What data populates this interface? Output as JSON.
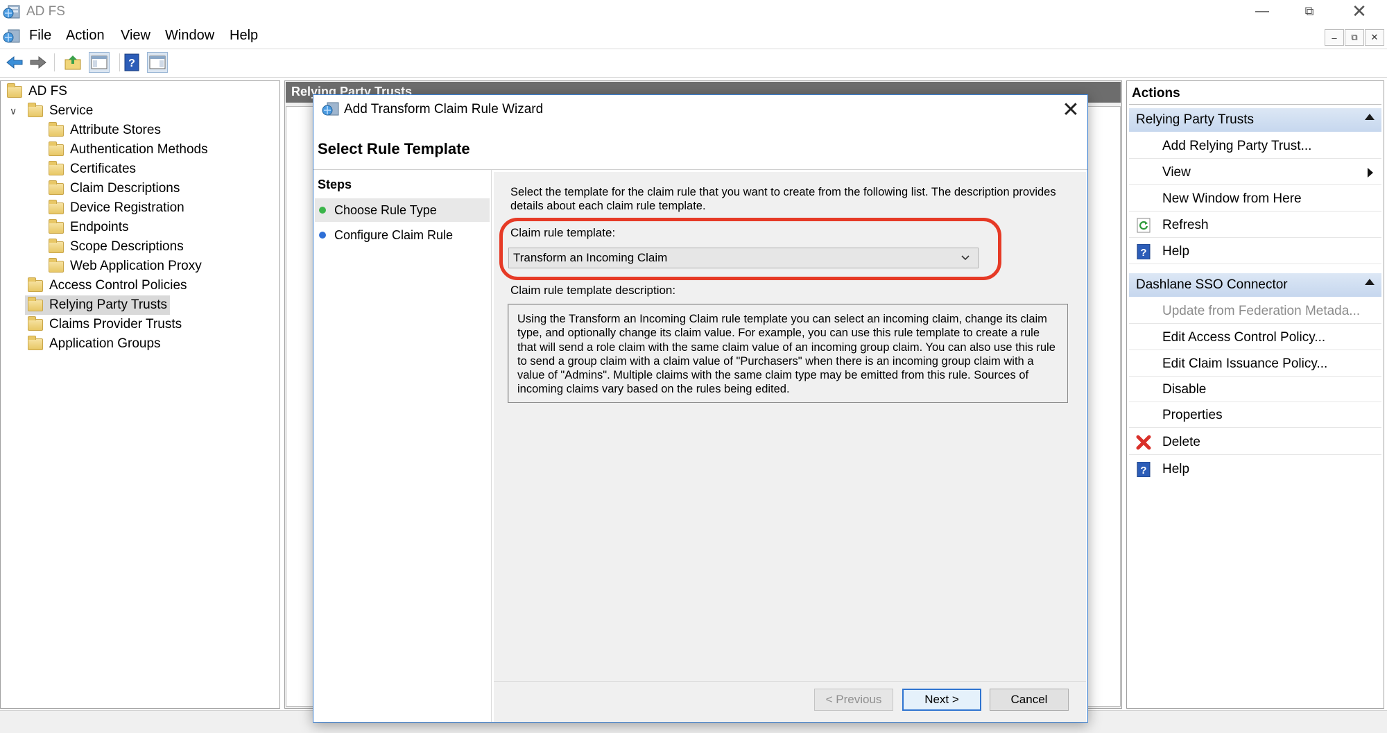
{
  "window": {
    "title": "AD FS"
  },
  "menu": {
    "items": [
      "File",
      "Action",
      "View",
      "Window",
      "Help"
    ]
  },
  "tree": {
    "root": "AD FS",
    "service": "Service",
    "service_children": [
      "Attribute Stores",
      "Authentication Methods",
      "Certificates",
      "Claim Descriptions",
      "Device Registration",
      "Endpoints",
      "Scope Descriptions",
      "Web Application Proxy"
    ],
    "others": [
      "Access Control Policies",
      "Relying Party Trusts",
      "Claims Provider Trusts",
      "Application Groups"
    ],
    "selected": "Relying Party Trusts"
  },
  "middle": {
    "header": "Relying Party Trusts"
  },
  "actions": {
    "title": "Actions",
    "section1": "Relying Party Trusts",
    "section1_items": [
      "Add Relying Party Trust...",
      "View",
      "New Window from Here",
      "Refresh",
      "Help"
    ],
    "section2": "Dashlane SSO Connector",
    "section2_items": [
      "Update from Federation Metada...",
      "Edit Access Control Policy...",
      "Edit Claim Issuance Policy...",
      "Disable",
      "Properties",
      "Delete",
      "Help"
    ]
  },
  "dialog": {
    "title": "Add Transform Claim Rule Wizard",
    "heading": "Select Rule Template",
    "steps_title": "Steps",
    "steps": [
      "Choose Rule Type",
      "Configure Claim Rule"
    ],
    "step_colors": [
      "#3bb54a",
      "#2f6fd6"
    ],
    "description": "Select the template for the claim rule that you want to create from the following list. The description provides details about each claim rule template.",
    "template_label": "Claim rule template:",
    "template_value": "Transform an Incoming Claim",
    "template_desc_label": "Claim rule template description:",
    "template_desc": "Using the Transform an Incoming Claim rule template you can select an incoming claim, change its claim type, and optionally change its claim value.  For example, you can use this rule template to create a rule that will send a role claim with the same claim value of an incoming group claim.  You can also use this rule to send a group claim with a claim value of \"Purchasers\" when there is an incoming group claim with a value of \"Admins\".  Multiple claims with the same claim type may be emitted from this rule.  Sources of incoming claims vary based on the rules being edited.",
    "buttons": {
      "previous": "< Previous",
      "next": "Next >",
      "cancel": "Cancel"
    }
  },
  "colors": {
    "highlight": "#e63a26",
    "section_bg": "#c6d7ee",
    "focus": "#2f74d0"
  }
}
